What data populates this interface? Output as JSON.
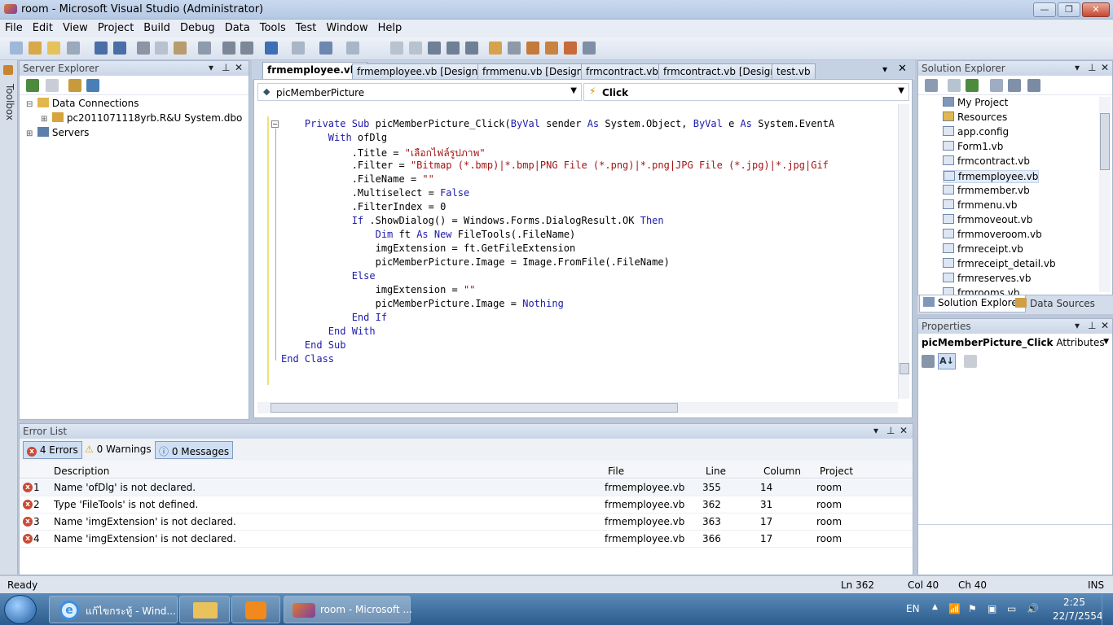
{
  "window": {
    "title": "room - Microsoft Visual Studio (Administrator)",
    "min": "—",
    "max": "❐",
    "close": "✕"
  },
  "menu": [
    "File",
    "Edit",
    "View",
    "Project",
    "Build",
    "Debug",
    "Data",
    "Tools",
    "Test",
    "Window",
    "Help"
  ],
  "left_tab": "Toolbox",
  "server_explorer": {
    "title": "Server Explorer",
    "items": [
      "Data Connections",
      "pc2011071118yrb.R&U System.dbo",
      "Servers"
    ]
  },
  "editor": {
    "tabs": [
      "frmemployee.vb*",
      "frmemployee.vb [Design]*",
      "frmmenu.vb [Design]",
      "frmcontract.vb",
      "frmcontract.vb [Design]",
      "test.vb"
    ],
    "object_dropdown": "picMemberPicture",
    "event_dropdown": "Click",
    "lines": [
      [
        {
          "k": "kw",
          "t": "    Private Sub "
        },
        {
          "k": "",
          "t": "picMemberPicture_Click("
        },
        {
          "k": "kw",
          "t": "ByVal"
        },
        {
          "k": "",
          "t": " sender "
        },
        {
          "k": "kw",
          "t": "As"
        },
        {
          "k": "",
          "t": " System.Object, "
        },
        {
          "k": "kw",
          "t": "ByVal"
        },
        {
          "k": "",
          "t": " e "
        },
        {
          "k": "kw",
          "t": "As"
        },
        {
          "k": "",
          "t": " System.EventA"
        }
      ],
      [
        {
          "k": "kw",
          "t": "        With "
        },
        {
          "k": "",
          "t": "ofDlg"
        }
      ],
      [
        {
          "k": "",
          "t": "            .Title = "
        },
        {
          "k": "str",
          "t": "\"เลือกไฟล์รูปภาพ\""
        }
      ],
      [
        {
          "k": "",
          "t": "            .Filter = "
        },
        {
          "k": "str",
          "t": "\"Bitmap (*.bmp)|*.bmp|PNG File (*.png)|*.png|JPG File (*.jpg)|*.jpg|Gif"
        }
      ],
      [
        {
          "k": "",
          "t": "            .FileName = "
        },
        {
          "k": "str",
          "t": "\"\""
        }
      ],
      [
        {
          "k": "",
          "t": "            .Multiselect = "
        },
        {
          "k": "kw",
          "t": "False"
        }
      ],
      [
        {
          "k": "",
          "t": "            .FilterIndex = 0"
        }
      ],
      [
        {
          "k": "kw",
          "t": "            If"
        },
        {
          "k": "",
          "t": " .ShowDialog() = Windows.Forms.DialogResult.OK "
        },
        {
          "k": "kw",
          "t": "Then"
        }
      ],
      [
        {
          "k": "kw",
          "t": "                Dim"
        },
        {
          "k": "",
          "t": " ft "
        },
        {
          "k": "kw",
          "t": "As New"
        },
        {
          "k": "",
          "t": " FileTools(.FileName)"
        }
      ],
      [
        {
          "k": "",
          "t": "                imgExtension = ft.GetFileExtension"
        }
      ],
      [
        {
          "k": "",
          "t": "                picMemberPicture.Image = Image.FromFile(.FileName)"
        }
      ],
      [
        {
          "k": "kw",
          "t": "            Else"
        }
      ],
      [
        {
          "k": "",
          "t": "                imgExtension = "
        },
        {
          "k": "str",
          "t": "\"\""
        }
      ],
      [
        {
          "k": "",
          "t": "                picMemberPicture.Image = "
        },
        {
          "k": "kw",
          "t": "Nothing"
        }
      ],
      [
        {
          "k": "kw",
          "t": "            End If"
        }
      ],
      [
        {
          "k": "kw",
          "t": "        End With"
        }
      ],
      [
        {
          "k": "kw",
          "t": "    End Sub"
        }
      ],
      [
        {
          "k": "kw",
          "t": "End Class"
        }
      ]
    ]
  },
  "solution_explorer": {
    "title": "Solution Explorer",
    "items": [
      "My Project",
      "Resources",
      "app.config",
      "Form1.vb",
      "frmcontract.vb",
      "frmemployee.vb",
      "frmmember.vb",
      "frmmenu.vb",
      "frmmoveout.vb",
      "frmmoveroom.vb",
      "frmreceipt.vb",
      "frmreceipt_detail.vb",
      "frmreserves.vb",
      "frmrooms.vb"
    ],
    "tabs": [
      "Solution Explorer",
      "Data Sources"
    ]
  },
  "properties": {
    "title": "Properties",
    "object_name": "picMemberPicture_Click",
    "object_type": "Attributes"
  },
  "error_list": {
    "title": "Error List",
    "filters": [
      "4 Errors",
      "0 Warnings",
      "0 Messages"
    ],
    "columns": [
      "Description",
      "File",
      "Line",
      "Column",
      "Project"
    ],
    "rows": [
      {
        "n": "1",
        "desc": "Name 'ofDlg' is not declared.",
        "file": "frmemployee.vb",
        "line": "355",
        "col": "14",
        "proj": "room"
      },
      {
        "n": "2",
        "desc": "Type 'FileTools' is not defined.",
        "file": "frmemployee.vb",
        "line": "362",
        "col": "31",
        "proj": "room"
      },
      {
        "n": "3",
        "desc": "Name 'imgExtension' is not declared.",
        "file": "frmemployee.vb",
        "line": "363",
        "col": "17",
        "proj": "room"
      },
      {
        "n": "4",
        "desc": "Name 'imgExtension' is not declared.",
        "file": "frmemployee.vb",
        "line": "366",
        "col": "17",
        "proj": "room"
      }
    ]
  },
  "statusbar": {
    "state": "Ready",
    "ln": "Ln 362",
    "col": "Col 40",
    "ch": "Ch 40",
    "mode": "INS"
  },
  "taskbar": {
    "tasks": [
      "แก้ไขกระทู้ - Wind...",
      "room - Microsoft ..."
    ],
    "lang": "EN",
    "time": "2:25",
    "date": "22/7/2554"
  }
}
